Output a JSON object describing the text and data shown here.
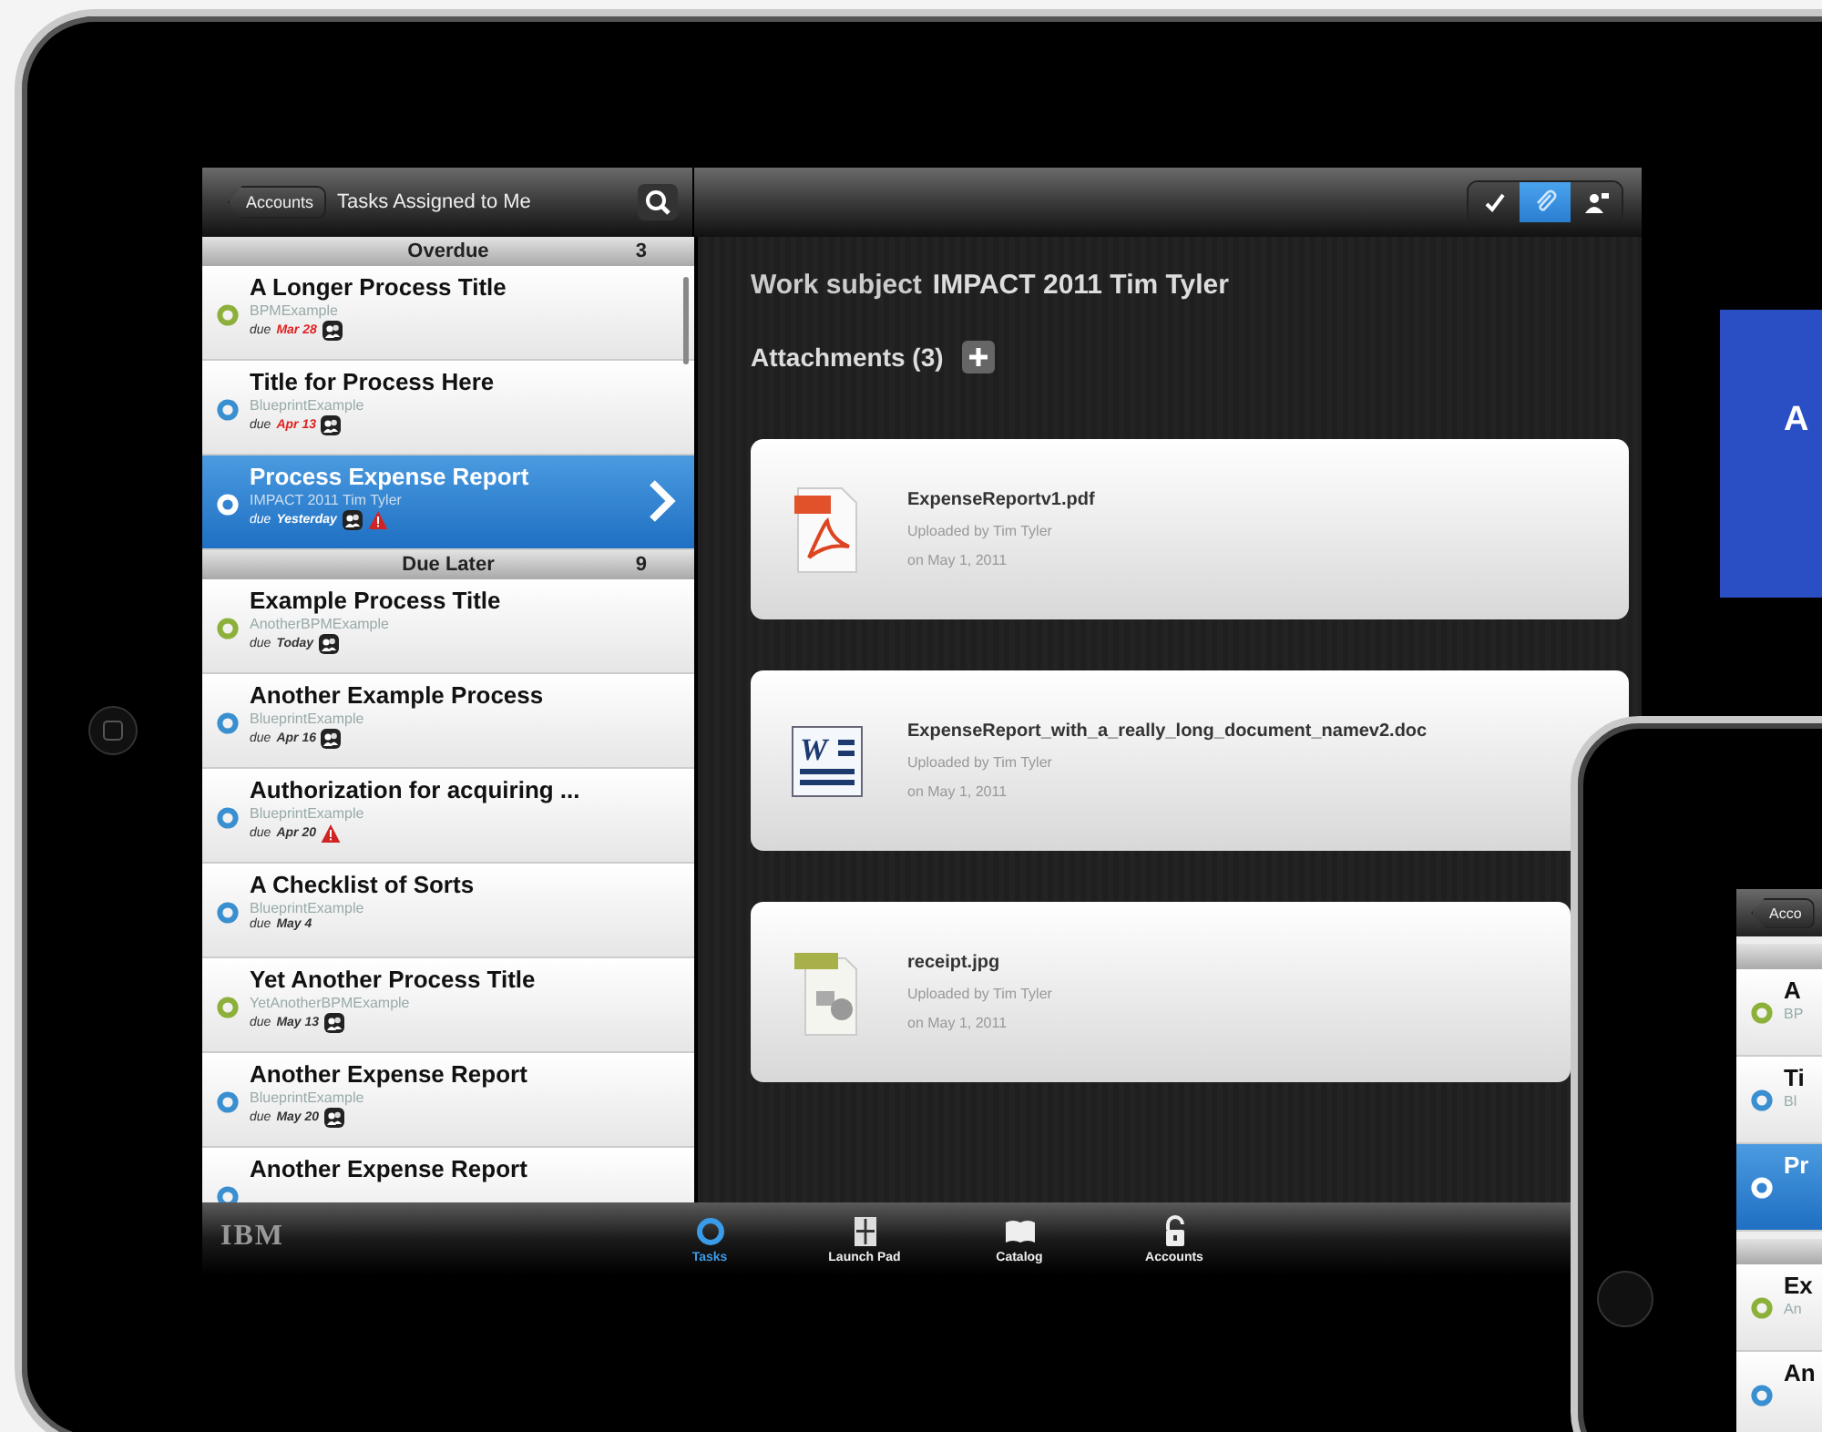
{
  "tablet": {
    "nav": {
      "back": "Accounts",
      "title": "Tasks Assigned to Me"
    },
    "toolbar": [
      {
        "kind": "check",
        "selected": false
      },
      {
        "kind": "attach",
        "selected": true
      },
      {
        "kind": "person",
        "selected": false
      }
    ],
    "sections": [
      {
        "title": "Overdue",
        "count": "3",
        "rows": [
          {
            "title": "A Longer Process Title",
            "subtitle": "BPMExample",
            "due_label": "due",
            "due": "Mar 28",
            "overdue": true,
            "color": "#8db03a",
            "selected": false,
            "icons": [
              {
                "kind": "people"
              }
            ]
          },
          {
            "title": "Title for Process Here",
            "subtitle": "BlueprintExample",
            "due_label": "due",
            "due": "Apr 13",
            "overdue": true,
            "color": "#3a8fd0",
            "selected": false,
            "icons": [
              {
                "kind": "people"
              }
            ]
          },
          {
            "title": "Process Expense Report",
            "subtitle": "IMPACT 2011 Tim Tyler",
            "due_label": "due",
            "due": "Yesterday",
            "overdue": false,
            "color": "#ffffff",
            "selected": true,
            "icons": [
              {
                "kind": "people"
              },
              {
                "kind": "alert"
              }
            ]
          }
        ]
      },
      {
        "title": "Due Later",
        "count": "9",
        "rows": [
          {
            "title": "Example Process Title",
            "subtitle": "AnotherBPMExample",
            "due_label": "due",
            "due": "Today",
            "overdue": false,
            "color": "#8db03a",
            "selected": false,
            "icons": [
              {
                "kind": "people"
              }
            ]
          },
          {
            "title": "Another Example Process",
            "subtitle": "BlueprintExample",
            "due_label": "due",
            "due": "Apr 16",
            "overdue": false,
            "color": "#3a8fd0",
            "selected": false,
            "icons": [
              {
                "kind": "people"
              }
            ]
          },
          {
            "title": "Authorization for acquiring ...",
            "subtitle": "BlueprintExample",
            "due_label": "due",
            "due": "Apr 20",
            "overdue": false,
            "color": "#3a8fd0",
            "selected": false,
            "icons": [
              {
                "kind": "alert"
              }
            ]
          },
          {
            "title": "A Checklist of Sorts",
            "subtitle": "BlueprintExample",
            "due_label": "due",
            "due": "May 4",
            "overdue": false,
            "color": "#3a8fd0",
            "selected": false,
            "icons": []
          },
          {
            "title": "Yet Another Process Title",
            "subtitle": "YetAnotherBPMExample",
            "due_label": "due",
            "due": "May 13",
            "overdue": false,
            "color": "#8db03a",
            "selected": false,
            "icons": [
              {
                "kind": "people"
              }
            ]
          },
          {
            "title": "Another Expense Report",
            "subtitle": "BlueprintExample",
            "due_label": "due",
            "due": "May 20",
            "overdue": false,
            "color": "#3a8fd0",
            "selected": false,
            "icons": [
              {
                "kind": "people"
              }
            ]
          },
          {
            "title": "Another Expense Report",
            "selected": false,
            "color": "#3a8fd0",
            "icons": []
          }
        ]
      }
    ],
    "detail": {
      "subject_label": "Work subject",
      "subject": "IMPACT 2011 Tim Tyler",
      "attachments_label": "Attachments (3)",
      "attachments": [
        {
          "kind": "pdf",
          "name": "ExpenseReportv1.pdf",
          "uploaded": "Uploaded by Tim Tyler",
          "date": "on May 1, 2011"
        },
        {
          "kind": "doc",
          "icon_text": "W",
          "name": "ExpenseReport_with_a_really_long_document_namev2.doc",
          "uploaded": "Uploaded by Tim Tyler",
          "date": "on May 1, 2011"
        },
        {
          "kind": "jpg",
          "name": "receipt.jpg",
          "uploaded": "Uploaded by Tim Tyler",
          "date": "on May 1, 2011"
        }
      ]
    },
    "logo": "IBM",
    "tabs": [
      {
        "label": "Tasks",
        "kind": "tasks",
        "selected": true
      },
      {
        "label": "Launch Pad",
        "kind": "launch",
        "selected": false
      },
      {
        "label": "Catalog",
        "kind": "catalog",
        "selected": false
      },
      {
        "label": "Accounts",
        "kind": "accounts",
        "selected": false
      }
    ]
  },
  "banner": {
    "text": "A"
  },
  "phone": {
    "back": "Acco",
    "rows": [
      {
        "kind": "header"
      },
      {
        "kind": "row",
        "title": "A",
        "subtitle": "BP",
        "color": "#8db03a",
        "selected": false
      },
      {
        "kind": "row",
        "title": "Ti",
        "subtitle": "Bl",
        "color": "#3a8fd0",
        "selected": false
      },
      {
        "kind": "row",
        "title": "Pr",
        "color": "#ffffff",
        "selected": true
      },
      {
        "kind": "header"
      },
      {
        "kind": "row",
        "title": "Ex",
        "subtitle": "An",
        "color": "#8db03a",
        "selected": false
      },
      {
        "kind": "row",
        "title": "An",
        "color": "#3a8fd0",
        "selected": false
      }
    ]
  }
}
